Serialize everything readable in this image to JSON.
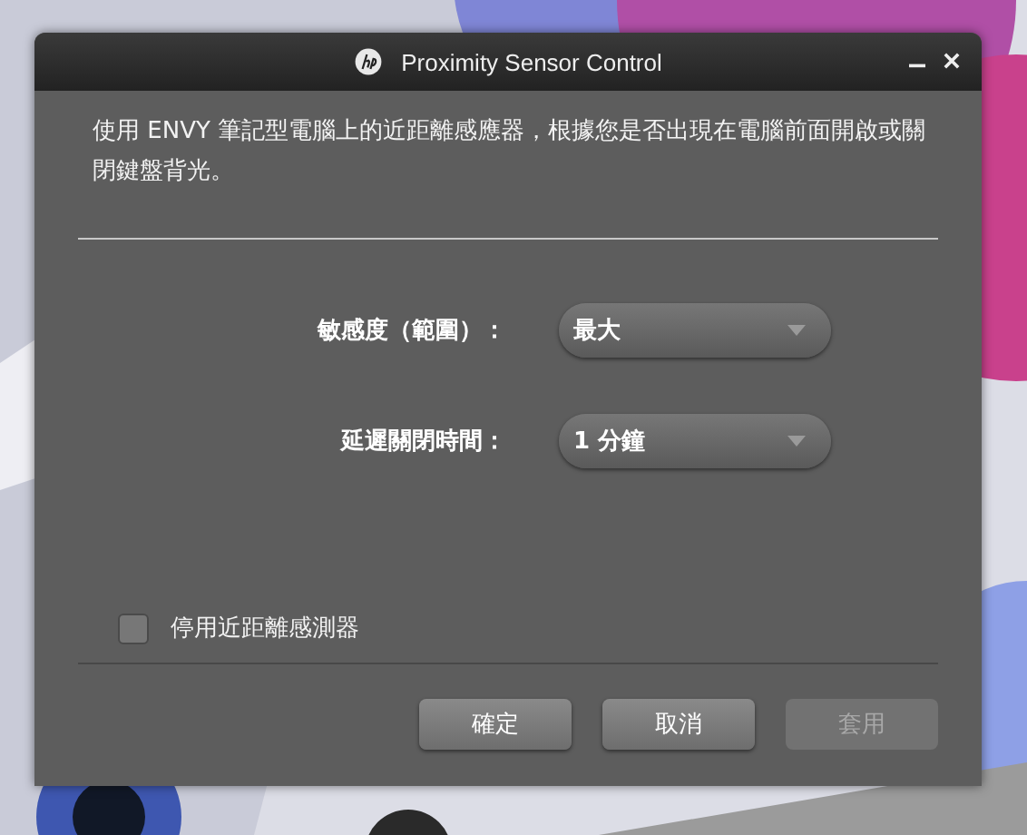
{
  "window": {
    "title": "Proximity Sensor Control"
  },
  "description": "使用 ENVY 筆記型電腦上的近距離感應器，根據您是否出現在電腦前面開啟或關閉鍵盤背光。",
  "settings": [
    {
      "label": "敏感度（範圍）：",
      "value": "最大"
    },
    {
      "label": "延遲關閉時間：",
      "value": "1 分鐘"
    }
  ],
  "disable_sensor": {
    "label": "停用近距離感測器",
    "checked": false
  },
  "buttons": [
    {
      "label": "確定",
      "disabled": false
    },
    {
      "label": "取消",
      "disabled": false
    },
    {
      "label": "套用",
      "disabled": true
    }
  ]
}
